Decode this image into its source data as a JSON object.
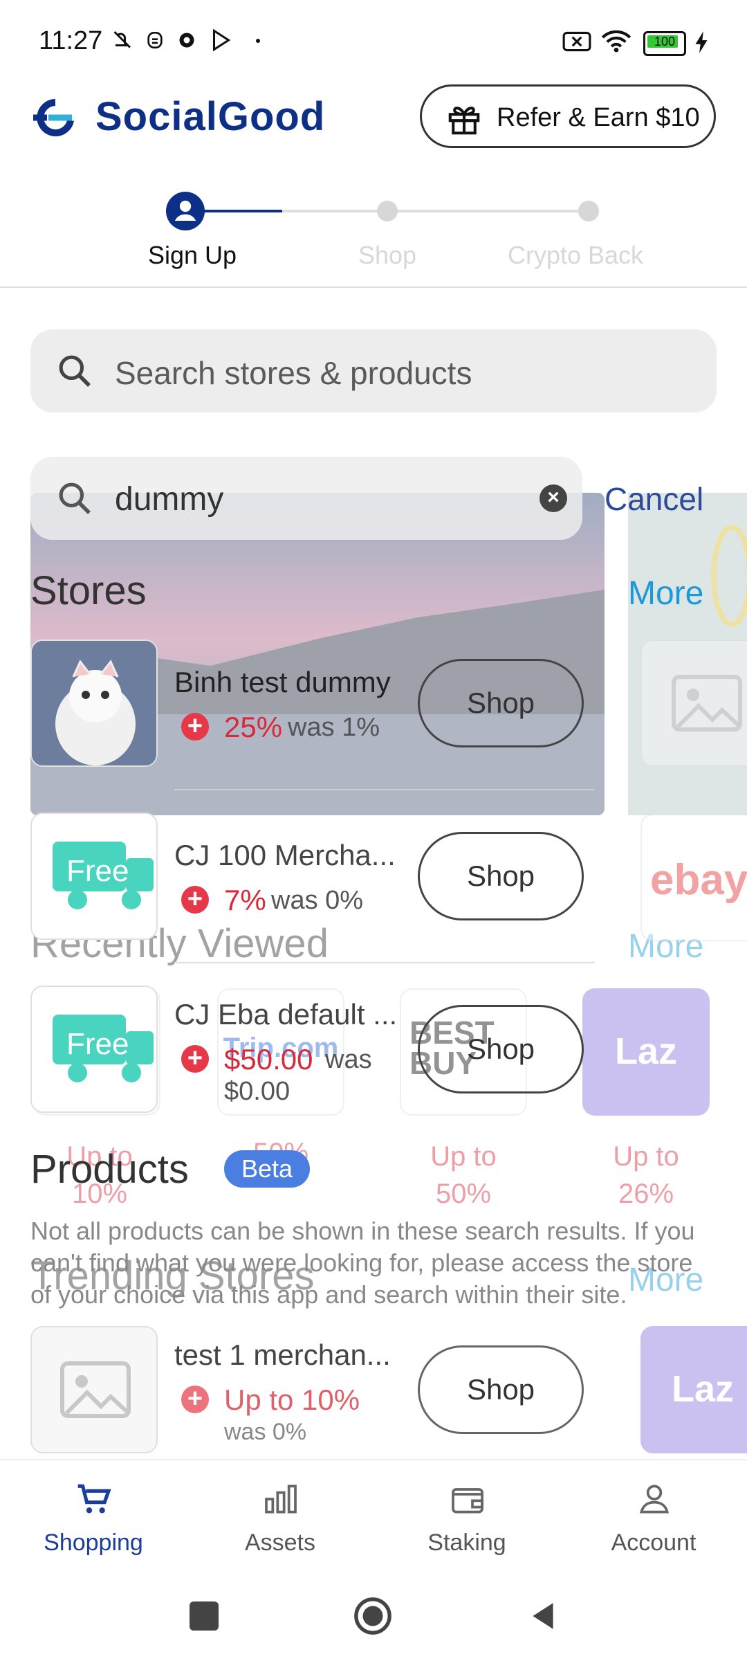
{
  "status_bar": {
    "time": "11:27",
    "battery": "100"
  },
  "header": {
    "brand": "SocialGood",
    "refer_label": "Refer & Earn $10"
  },
  "stepper": {
    "steps": [
      "Sign Up",
      "Shop",
      "Crypto Back"
    ]
  },
  "search": {
    "placeholder": "Search stores & products",
    "overlay_query": "dummy",
    "cancel_label": "Cancel"
  },
  "stores_section": {
    "title": "Stores",
    "more": "More",
    "items": [
      {
        "name": "Binh test dummy",
        "rate": "25%",
        "was": "was 1%",
        "shop": "Shop"
      },
      {
        "name": "CJ 100 Mercha...",
        "rate": "7%",
        "was": "was 0%",
        "shop": "Shop"
      },
      {
        "name": "CJ Eba default ...",
        "rate": "$50.00",
        "was": "was",
        "was2": "$0.00",
        "shop": "Shop"
      }
    ]
  },
  "recently_viewed": {
    "title": "Recently Viewed",
    "more": "More",
    "items": [
      {
        "label": "Up to",
        "value": "10%"
      },
      {
        "label": "Trip.com",
        "value": "50%"
      },
      {
        "label": "Up to",
        "value": "50%"
      },
      {
        "label": "Up to",
        "value": "26%"
      }
    ],
    "bestbuy_text": "BEST BUY",
    "laz_text": "Laz",
    "free_text": "Free"
  },
  "products_section": {
    "title": "Products",
    "badge": "Beta",
    "note": "Not all products can be shown in these search results. If you can't find what you were looking for, please access the store of your choice via this app and search within their site."
  },
  "trending": {
    "title": "Trending Stores",
    "more": "More",
    "items": [
      {
        "name": "test 1 merchan...",
        "rate": "Up to 10%",
        "was": "was 0%",
        "shop": "Shop"
      }
    ],
    "ebay_text": "ebay"
  },
  "bottom_nav": {
    "items": [
      "Shopping",
      "Assets",
      "Staking",
      "Account"
    ],
    "active_color": "#1a3e9a"
  }
}
